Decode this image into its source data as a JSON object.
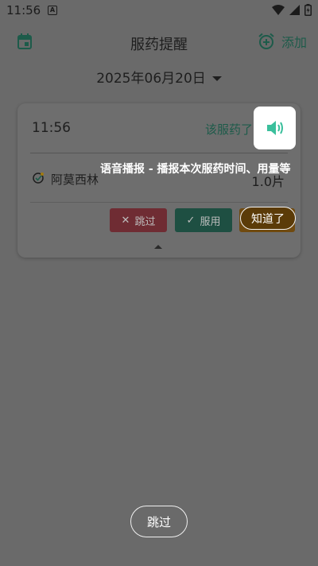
{
  "status_bar": {
    "time": "11:56",
    "notification_icon": "a-icon",
    "wifi_icon": "wifi-icon",
    "signal_icon": "signal-icon",
    "battery_icon": "battery-icon"
  },
  "app_bar": {
    "title": "服药提醒",
    "add_label": "添加",
    "calendar_icon": "calendar-icon",
    "alarm_icon": "alarm-add-icon"
  },
  "date_selector": {
    "date": "2025年06月20日"
  },
  "card": {
    "time": "11:56",
    "status": "该服药了",
    "drug": {
      "name": "阿莫西林",
      "dose": "1.0片"
    },
    "actions": {
      "skip": "跳过",
      "take": "服用"
    }
  },
  "guide": {
    "text": "语音播报 - 播报本次服药时间、用量等",
    "got_it": "知道了",
    "skip": "跳过"
  },
  "colors": {
    "accent": "#1d5b4a",
    "speaker": "#3bbf9c",
    "skip_button": "#6f2c33",
    "take_button": "#1e4f42",
    "overlay": "#6a6a6a"
  }
}
